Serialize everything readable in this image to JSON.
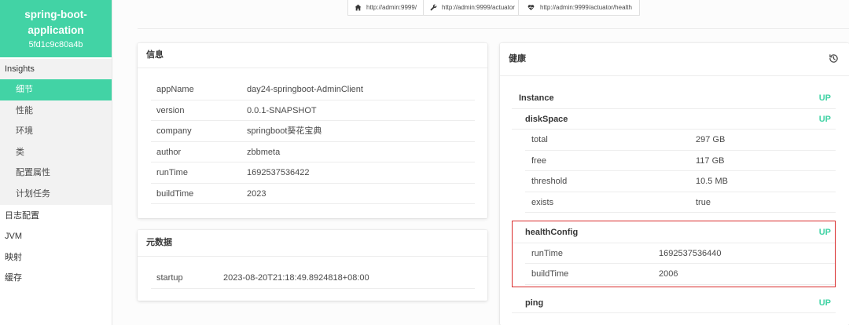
{
  "colors": {
    "accent": "#42d3a5",
    "status_up": "#42d3a5",
    "highlight_border": "#d92b2b"
  },
  "sidebar": {
    "app_name": "spring-boot-application",
    "instance_id": "5fd1c9c80a4b",
    "group_label": "Insights",
    "group_items": [
      {
        "label": "细节",
        "active": true
      },
      {
        "label": "性能"
      },
      {
        "label": "环境"
      },
      {
        "label": "类"
      },
      {
        "label": "配置属性"
      },
      {
        "label": "计划任务"
      }
    ],
    "items": [
      {
        "label": "日志配置"
      },
      {
        "label": "JVM"
      },
      {
        "label": "映射"
      },
      {
        "label": "缓存"
      }
    ]
  },
  "topbar": {
    "links": [
      {
        "icon": "home-icon",
        "label": "http://admin:9999/"
      },
      {
        "icon": "wrench-icon",
        "label": "http://admin:9999/actuator"
      },
      {
        "icon": "heart-icon",
        "label": "http://admin:9999/actuator/health"
      }
    ]
  },
  "info": {
    "title": "信息",
    "rows": [
      {
        "key": "appName",
        "value": "day24-springboot-AdminClient"
      },
      {
        "key": "version",
        "value": "0.0.1-SNAPSHOT"
      },
      {
        "key": "company",
        "value": "springboot葵花宝典"
      },
      {
        "key": "author",
        "value": "zbbmeta"
      },
      {
        "key": "runTime",
        "value": "1692537536422"
      },
      {
        "key": "buildTime",
        "value": "2023"
      }
    ]
  },
  "metadata": {
    "title": "元数据",
    "rows": [
      {
        "key": "startup",
        "value": "2023-08-20T21:18:49.8924818+08:00"
      }
    ]
  },
  "health": {
    "title": "健康",
    "history_icon": "history-icon",
    "instance": {
      "label": "Instance",
      "status": "UP"
    },
    "components": [
      {
        "name": "diskSpace",
        "status": "UP",
        "details": [
          {
            "key": "total",
            "value": "297 GB"
          },
          {
            "key": "free",
            "value": "117 GB"
          },
          {
            "key": "threshold",
            "value": "10.5 MB"
          },
          {
            "key": "exists",
            "value": "true"
          }
        ]
      },
      {
        "name": "healthConfig",
        "status": "UP",
        "highlighted": true,
        "details": [
          {
            "key": "runTime",
            "value": "1692537536440"
          },
          {
            "key": "buildTime",
            "value": "2006"
          }
        ]
      },
      {
        "name": "ping",
        "status": "UP",
        "details": []
      }
    ]
  }
}
